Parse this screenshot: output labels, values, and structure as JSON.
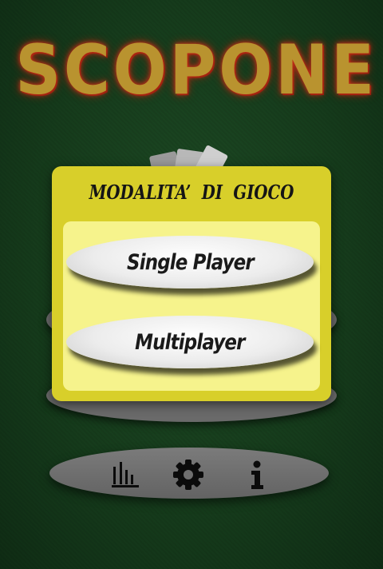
{
  "app": {
    "logo_text": "SCOPONE"
  },
  "dialog": {
    "title": "MODALITA’ DI GIOCO",
    "buttons": [
      {
        "label": "Single Player"
      },
      {
        "label": "Multiplayer"
      }
    ]
  },
  "toolbar": {
    "icons": [
      "statistics-icon",
      "settings-gear-icon",
      "info-icon"
    ]
  },
  "colors": {
    "felt": "#163c1c",
    "dialog_frame": "#d8cf2a",
    "dialog_body": "#f6f38c",
    "button": "#ececec",
    "toolbar": "#6f6f6f"
  }
}
